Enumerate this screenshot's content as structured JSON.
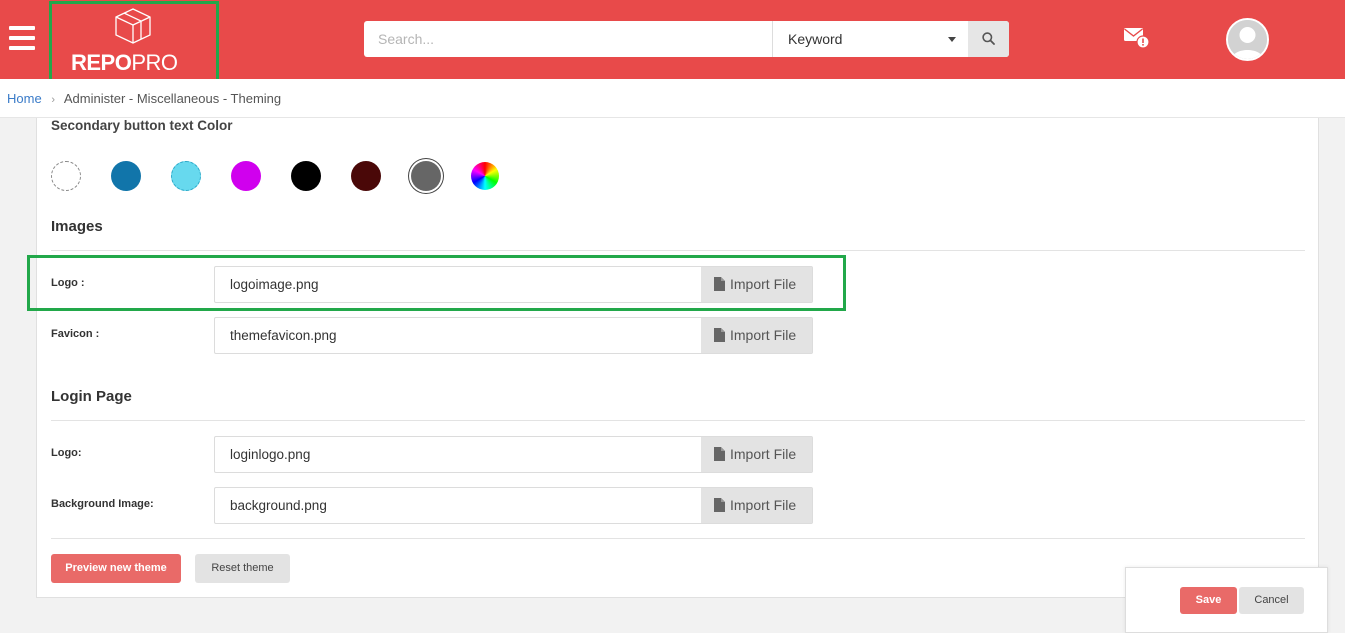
{
  "header": {
    "logo_bold": "REPO",
    "logo_light": "PRO",
    "search_placeholder": "Search...",
    "search_scope": "Keyword"
  },
  "breadcrumb": {
    "home": "Home",
    "path": "Administer - Miscellaneous - Theming"
  },
  "secondary_text_color": {
    "label": "Secondary button text Color",
    "swatches": [
      "#ffffff",
      "#1175aa",
      "#67d9ee",
      "#d000ee",
      "#000000",
      "#4a0808",
      "#666666"
    ],
    "selected_index": 6
  },
  "images": {
    "heading": "Images",
    "logo_label": "Logo :",
    "logo_file": "logoimage.png",
    "favicon_label": "Favicon :",
    "favicon_file": "themefavicon.png"
  },
  "login_page": {
    "heading": "Login Page",
    "logo_label": "Logo:",
    "logo_file": "loginlogo.png",
    "bg_label": "Background Image:",
    "bg_file": "background.png"
  },
  "import_label": "Import File",
  "actions": {
    "preview": "Preview new theme",
    "reset": "Reset theme",
    "save": "Save",
    "cancel": "Cancel"
  },
  "colors": {
    "header": "#e84a4a",
    "accent_button": "#e96a68",
    "highlight": "#22a84a"
  }
}
